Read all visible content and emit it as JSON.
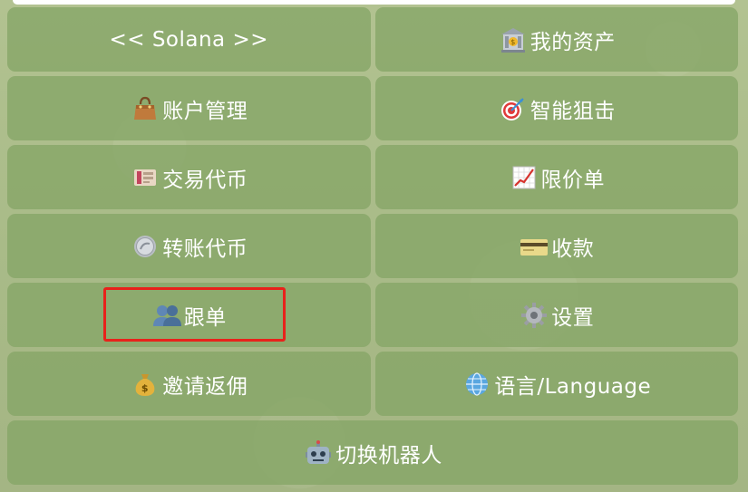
{
  "keyboard": {
    "rows": [
      [
        {
          "label": "<< Solana >>",
          "icon": ""
        },
        {
          "label": "我的资产",
          "icon": "bank-icon"
        }
      ],
      [
        {
          "label": "账户管理",
          "icon": "handbag-icon"
        },
        {
          "label": "智能狙击",
          "icon": "target-icon"
        }
      ],
      [
        {
          "label": "交易代币",
          "icon": "cash-icon"
        },
        {
          "label": "限价单",
          "icon": "chart-up-icon"
        }
      ],
      [
        {
          "label": "转账代币",
          "icon": "coin-icon"
        },
        {
          "label": "收款",
          "icon": "credit-card-icon"
        }
      ],
      [
        {
          "label": "跟单",
          "icon": "users-icon"
        },
        {
          "label": "设置",
          "icon": "gear-icon"
        }
      ],
      [
        {
          "label": "邀请返佣",
          "icon": "money-bag-icon"
        },
        {
          "label": "语言/Language",
          "icon": "globe-icon"
        }
      ],
      [
        {
          "label": "切换机器人",
          "icon": "robot-icon"
        }
      ]
    ]
  },
  "highlight_color": "#e8221b",
  "button_color": "#85a567"
}
